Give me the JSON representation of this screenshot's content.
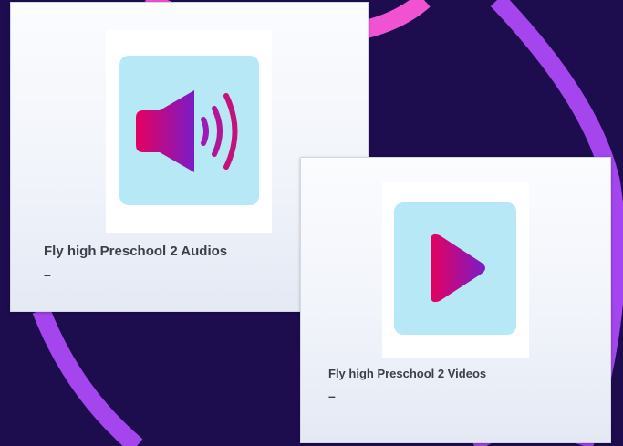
{
  "background": {
    "color": "#1d0d4f",
    "arc_colors": [
      "#f052d2",
      "#a445ee"
    ]
  },
  "cards": [
    {
      "title": "Fly high Preschool 2 Audios",
      "subtitle": "–",
      "icon": "speaker-icon",
      "tile_color": "#b7e8f6",
      "gradient": [
        "#e6005e",
        "#7a1cc7"
      ]
    },
    {
      "title": "Fly high Preschool 2 Videos",
      "subtitle": "–",
      "icon": "play-icon",
      "tile_color": "#b7e8f6",
      "gradient": [
        "#e6005e",
        "#7a1cc7"
      ]
    }
  ]
}
